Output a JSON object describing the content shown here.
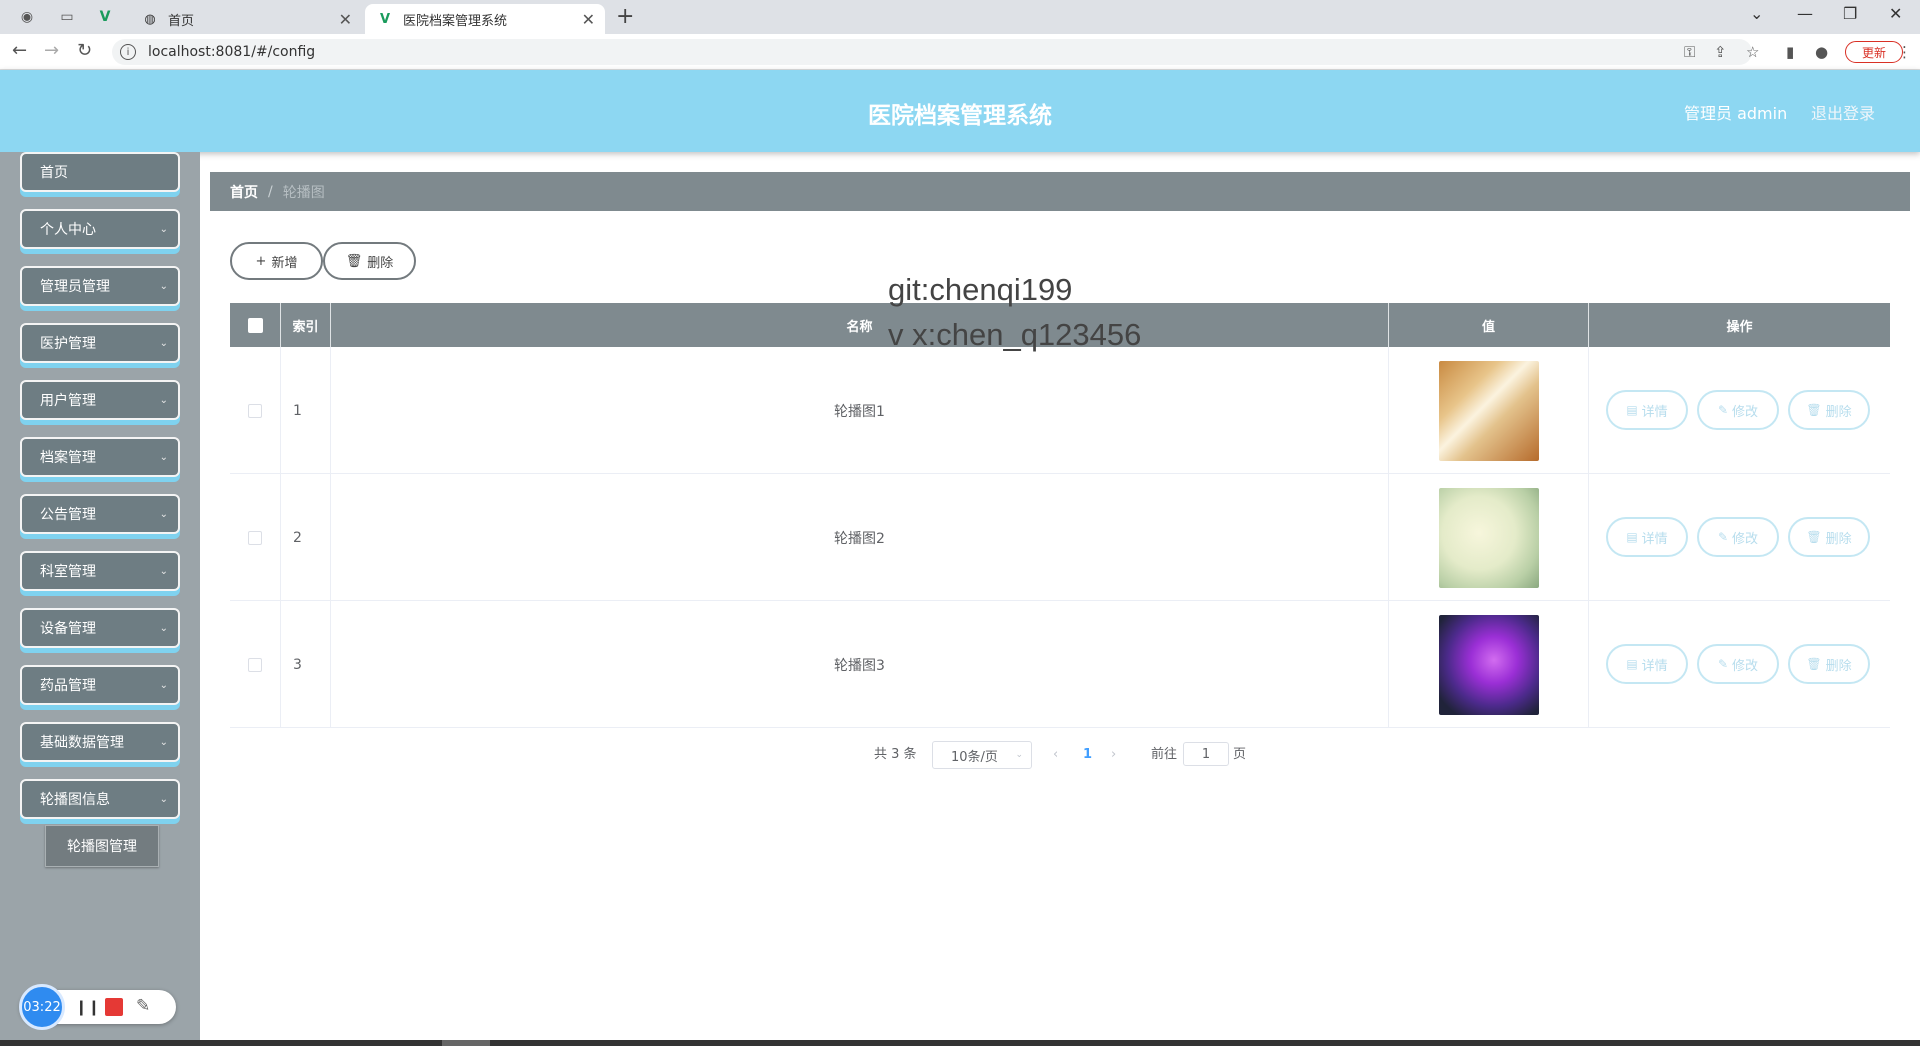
{
  "browser": {
    "tabs": [
      {
        "label": "首页",
        "active": false
      },
      {
        "label": "医院档案管理系统",
        "active": true
      }
    ],
    "url": "localhost:8081/#/config",
    "update_label": "更新"
  },
  "header": {
    "title": "医院档案管理系统",
    "user": "管理员 admin",
    "logout": "退出登录"
  },
  "sidebar": {
    "items": [
      {
        "label": "首页",
        "expandable": false
      },
      {
        "label": "个人中心",
        "expandable": true
      },
      {
        "label": "管理员管理",
        "expandable": true
      },
      {
        "label": "医护管理",
        "expandable": true
      },
      {
        "label": "用户管理",
        "expandable": true
      },
      {
        "label": "档案管理",
        "expandable": true
      },
      {
        "label": "公告管理",
        "expandable": true
      },
      {
        "label": "科室管理",
        "expandable": true
      },
      {
        "label": "设备管理",
        "expandable": true
      },
      {
        "label": "药品管理",
        "expandable": true
      },
      {
        "label": "基础数据管理",
        "expandable": true
      },
      {
        "label": "轮播图信息",
        "expandable": true
      }
    ],
    "submenu_label": "轮播图管理"
  },
  "breadcrumb": {
    "home": "首页",
    "separator": "/",
    "current": "轮播图"
  },
  "toolbar": {
    "add_label": "新增",
    "delete_label": "删除"
  },
  "watermark": {
    "line1": "git:chenqi199",
    "line2": "v x:chen_q123456"
  },
  "table": {
    "columns": {
      "index": "索引",
      "name": "名称",
      "value": "值",
      "actions": "操作"
    },
    "rows": [
      {
        "index": "1",
        "name": "轮播图1",
        "image": "thumb-beige-paper"
      },
      {
        "index": "2",
        "name": "轮播图2",
        "image": "thumb-pale-green"
      },
      {
        "index": "3",
        "name": "轮播图3",
        "image": "thumb-purple-dark"
      }
    ],
    "actions": {
      "detail": "详情",
      "edit": "修改",
      "delete": "删除"
    }
  },
  "pagination": {
    "total": "共 3 条",
    "page_size": "10条/页",
    "current_page": "1",
    "goto_prefix": "前往",
    "goto_value": "1",
    "goto_suffix": "页"
  },
  "recorder": {
    "time": "03:22"
  },
  "colors": {
    "header_bg": "#8dd7f2",
    "sidebar_bg": "#9ba4a9",
    "menu_item_bg": "#6e7d83",
    "table_header_bg": "#7f8a8f",
    "accent_blue": "#7fd2ef"
  }
}
